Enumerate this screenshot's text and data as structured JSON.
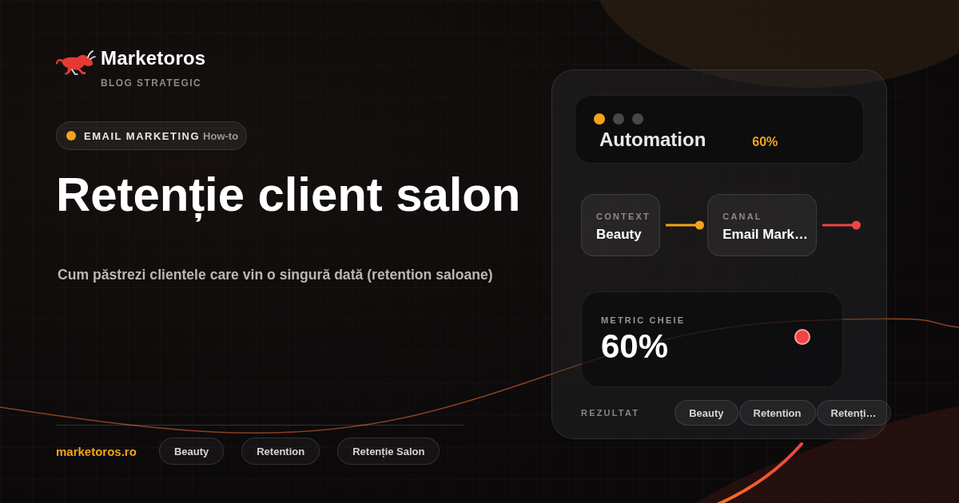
{
  "brand": {
    "name": "Marketoros",
    "tagline": "BLOG STRATEGIC"
  },
  "category": {
    "label": "EMAIL MARKETING",
    "type": "How-to"
  },
  "headline": "Retenție client salon",
  "subtitle": "Cum păstrezi clientele care vin o singură dată (retention saloane)",
  "footer": {
    "site": "marketoros.ro",
    "tags": [
      "Beauty",
      "Retention",
      "Retenție Salon"
    ]
  },
  "panel": {
    "header": {
      "indicators": [
        {
          "on": true
        },
        {
          "on": false
        },
        {
          "on": false
        }
      ],
      "title": "Automation",
      "value": "60%"
    },
    "nodes": [
      {
        "label": "CONTEXT",
        "value": "Beauty",
        "color": "#f5a31a"
      },
      {
        "label": "CANAL",
        "value": "Email Mark…",
        "color": "#ef4444"
      }
    ],
    "metric": {
      "label": "METRIC CHEIE",
      "value": "60%"
    },
    "result": {
      "label": "REZULTAT",
      "tags": [
        "Beauty",
        "Retention",
        "Retenți…"
      ]
    }
  }
}
